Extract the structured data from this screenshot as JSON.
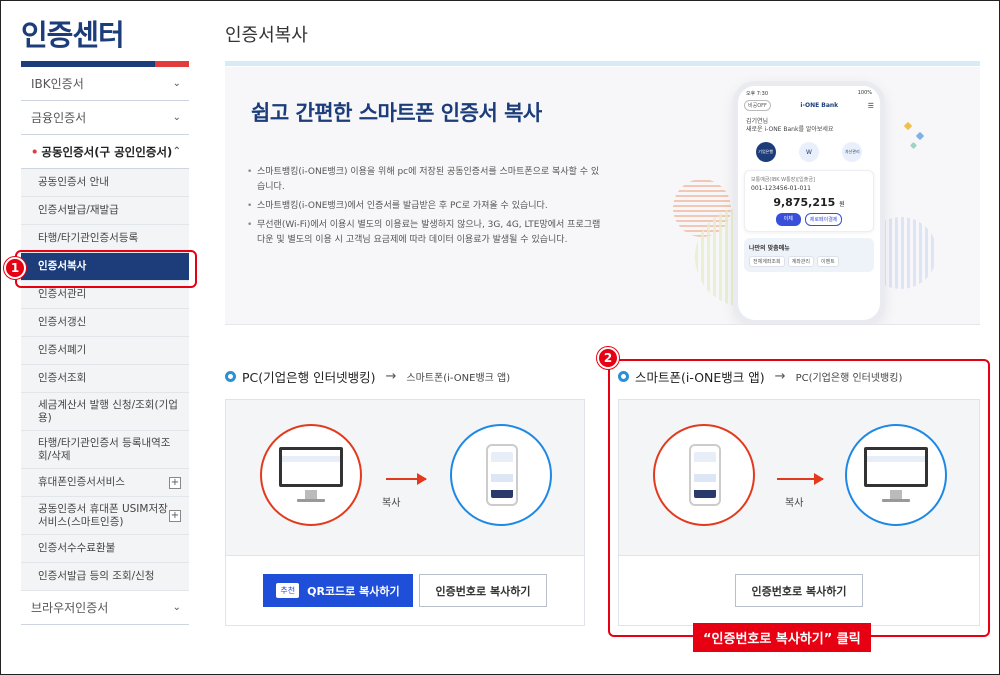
{
  "sidebar": {
    "title": "인증센터",
    "top_items": [
      {
        "label": "IBK인증서"
      },
      {
        "label": "금융인증서"
      },
      {
        "label": "공동인증서(구 공인인증서)"
      },
      {
        "label": "브라우저인증서"
      }
    ],
    "sub_items": [
      {
        "label": "공동인증서 안내"
      },
      {
        "label": "인증서발급/재발급"
      },
      {
        "label": "타행/타기관인증서등록"
      },
      {
        "label": "인증서복사"
      },
      {
        "label": "인증서관리"
      },
      {
        "label": "인증서갱신"
      },
      {
        "label": "인증서폐기"
      },
      {
        "label": "인증서조회"
      },
      {
        "label": "세금계산서 발행 신청/조회(기업용)"
      },
      {
        "label": "타행/타기관인증서 등록내역조회/삭제"
      },
      {
        "label": "휴대폰인증서서비스"
      },
      {
        "label": "공동인증서 휴대폰 USIM저장서비스(스마트인증)"
      },
      {
        "label": "인증서수수료환불"
      },
      {
        "label": "인증서발급 등의 조회/신청"
      }
    ]
  },
  "page": {
    "title": "인증서복사"
  },
  "hero": {
    "heading": "쉽고 간편한 스마트폰 인증서 복사",
    "bullets": [
      "스마트뱅킹(i-ONE뱅크) 이용을 위해 pc에 저장된 공동인증서를 스마트폰으로 복사할 수 있습니다.",
      "스마트뱅킹(i-ONE뱅크)에서 인증서를 발급받은 후 PC로 가져올 수 있습니다.",
      "무선랜(Wi-Fi)에서 이용시 별도의 이용료는 발생하지 않으나, 3G, 4G, LTE망에서 프로그램 다운 및 별도의 이용 시 고객님 요금제에 따라 데이터 이용료가 발생될 수 있습니다."
    ],
    "phone": {
      "time": "오후 7:30",
      "battery": "100%",
      "pill": "비공OFF",
      "bank": "i-ONE Bank",
      "greeting_1": "김기연님",
      "greeting_2": "새로운 i-ONE Bank를 알아보세요",
      "icons": [
        "기업은행",
        "W",
        "자산관리"
      ],
      "account_name": "보통예금(IBK W통장)[입출금]",
      "account_number": "001-123456-01-011",
      "amount": "9,875,215",
      "amount_unit": "원",
      "btn_transfer": "이체",
      "btn_zeropay": "제로페이결제",
      "menu_title": "나만의 맞춤메뉴",
      "tags": [
        "전체계좌조회",
        "계좌관리",
        "이벤트"
      ]
    }
  },
  "section_pc": {
    "main": "PC(기업은행 인터넷뱅킹)",
    "arrow": "→",
    "sub": "스마트폰(i-ONE뱅크 앱)",
    "flow_label": "복사",
    "btn_qr_tag": "추천",
    "btn_qr": "QR코드로 복사하기",
    "btn_num": "인증번호로 복사하기"
  },
  "section_phone": {
    "main": "스마트폰(i-ONE뱅크 앱)",
    "arrow": "→",
    "sub": "PC(기업은행 인터넷뱅킹)",
    "flow_label": "복사",
    "btn_num": "인증번호로 복사하기"
  },
  "annotations": {
    "badge_1": "1",
    "badge_2": "2",
    "callout": "“인증번호로 복사하기” 클릭"
  },
  "colors": {
    "brand_navy": "#1c3d7a",
    "primary_blue": "#1f4fd9",
    "annotation_red": "#e60012"
  }
}
